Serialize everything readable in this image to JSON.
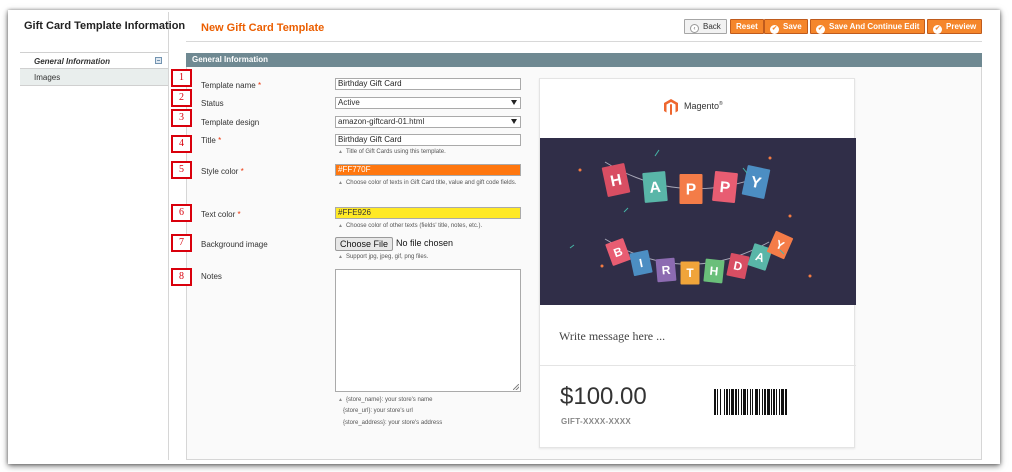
{
  "sidebar": {
    "title": "Gift Card Template Information",
    "items": [
      {
        "label": "General Information"
      },
      {
        "label": "Images"
      }
    ]
  },
  "header": {
    "title": "New Gift Card Template",
    "buttons": {
      "back": "Back",
      "reset": "Reset",
      "save": "Save",
      "save_continue": "Save And Continue Edit",
      "preview": "Preview"
    }
  },
  "section": {
    "title": "General Information"
  },
  "markers": [
    "1",
    "2",
    "3",
    "4",
    "5",
    "6",
    "7",
    "8"
  ],
  "form": {
    "template_name": {
      "label": "Template name",
      "required": "*",
      "value": "Birthday Gift Card"
    },
    "status": {
      "label": "Status",
      "value": "Active"
    },
    "template_design": {
      "label": "Template design",
      "value": "amazon-giftcard-01.html"
    },
    "title": {
      "label": "Title",
      "required": "*",
      "value": "Birthday Gift Card",
      "note": "Title of Gift Cards using this template."
    },
    "style_color": {
      "label": "Style color",
      "required": "*",
      "value": "#FF770F",
      "note": "Choose color of texts in Gift Card title, value and gift code fields.",
      "swatch": "#FF770F"
    },
    "text_color": {
      "label": "Text color",
      "required": "*",
      "value": "#FFE926",
      "note": "Choose color of other texts (fields' title, notes, etc.).",
      "swatch": "#FFE926"
    },
    "background_image": {
      "label": "Background image",
      "button": "Choose File",
      "status": "No file chosen",
      "note": "Support jpg, jpeg, gif, png files."
    },
    "notes": {
      "label": "Notes",
      "help": [
        "{store_name}: your store's name",
        "{store_url}: your store's url",
        "{store_address}: your store's address"
      ]
    }
  },
  "preview": {
    "brand": "Magento",
    "brand_mark": "®",
    "message": "Write message here ...",
    "value": "$100.00",
    "code": "GIFT-XXXX-XXXX",
    "banner_letters_top": [
      "H",
      "A",
      "P",
      "P",
      "Y"
    ],
    "banner_letters_bottom": [
      "B",
      "I",
      "R",
      "T",
      "H",
      "D",
      "A",
      "Y"
    ],
    "colors": {
      "banner_bg": "#302E48",
      "accent": "#F5862B"
    }
  }
}
